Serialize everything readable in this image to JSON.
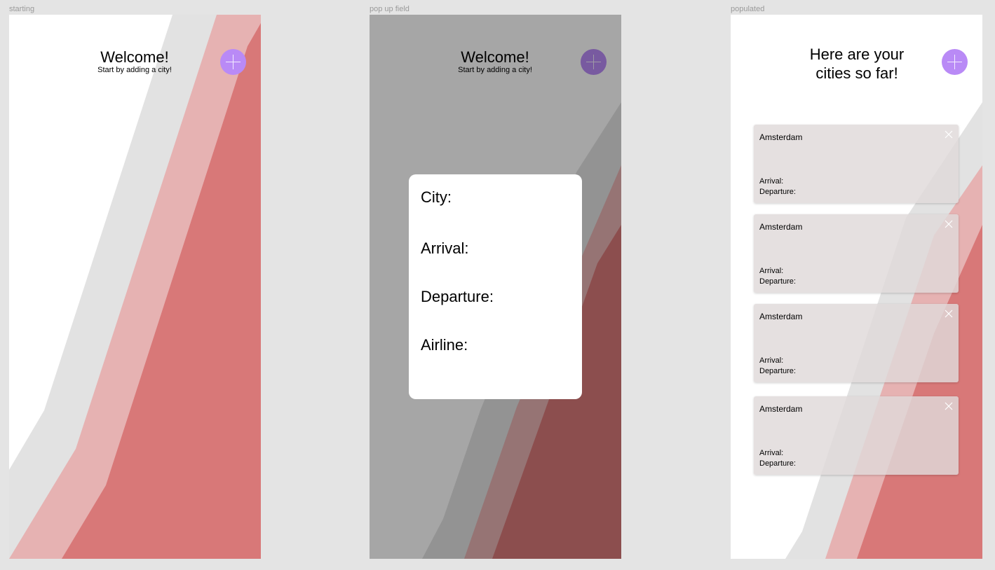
{
  "frames": {
    "starting": {
      "label": "starting",
      "title": "Welcome!",
      "subtitle": "Start by adding a city!"
    },
    "popup": {
      "label": "pop up field",
      "title": "Welcome!",
      "subtitle": "Start by adding a city!",
      "fields": [
        "City:",
        "Arrival:",
        "Departure:",
        "Airline:"
      ]
    },
    "populated": {
      "label": "populated",
      "title_line1": "Here are your",
      "title_line2": "cities so far!",
      "cards": [
        {
          "city": "Amsterdam",
          "arrival": "Arrival:",
          "departure": "Departure:"
        },
        {
          "city": "Amsterdam",
          "arrival": "Arrival:",
          "departure": "Departure:"
        },
        {
          "city": "Amsterdam",
          "arrival": "Arrival:",
          "departure": "Departure:"
        },
        {
          "city": "Amsterdam",
          "arrival": "Arrival:",
          "departure": "Departure:"
        }
      ]
    }
  },
  "colors": {
    "canvas": "#e4e4e4",
    "accent_button": "#b98af6",
    "band_light_gray": "#e2e2e2",
    "band_pink": "#e6b2b2",
    "band_red": "#d87878"
  },
  "icons": {
    "add": "plus-icon",
    "remove": "close-icon"
  }
}
